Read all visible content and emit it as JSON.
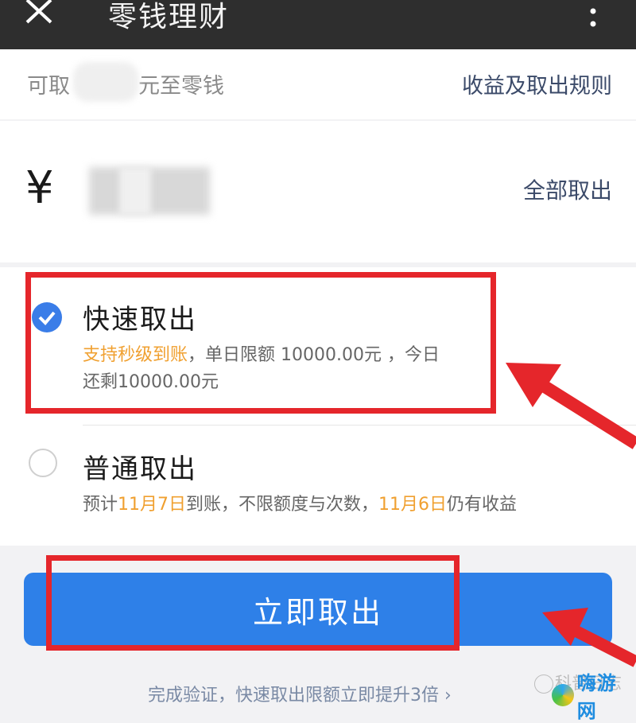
{
  "titlebar": {
    "title": "零钱理财"
  },
  "info": {
    "available_prefix": "可取",
    "available_suffix": "元至零钱",
    "rules_link": "收益及取出规则"
  },
  "amount": {
    "currency": "¥",
    "withdraw_all": "全部取出"
  },
  "options": [
    {
      "title": "快速取出",
      "highlight": "支持秒级到账",
      "desc_line1_rest": "，单日限额 10000.00元 ，今日",
      "desc_line2": "还剩10000.00元",
      "selected": true
    },
    {
      "title": "普通取出",
      "desc_part1": "预计",
      "date1": "11月7日",
      "desc_part2": "到账，不限额度与次数，",
      "date2": "11月6日",
      "desc_part3": "仍有收益",
      "selected": false
    }
  ],
  "submit_label": "立即取出",
  "footer_text": "完成验证，快速取出限额立即提升3倍 ›",
  "watermarks": {
    "wechat_account": "科普日志",
    "site": "嗨游网"
  },
  "colors": {
    "accent": "#2e80e8",
    "highlight": "#f0a030",
    "annotation": "#e5262b"
  }
}
